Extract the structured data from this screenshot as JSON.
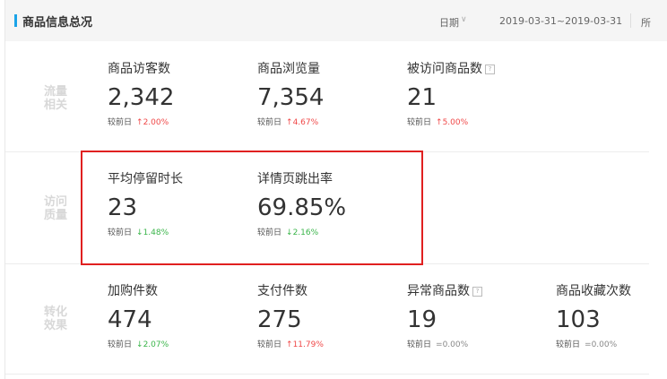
{
  "header": {
    "title": "商品信息总况",
    "date_label": "日期",
    "date_range": "2019-03-31~2019-03-31",
    "extra_text": "所",
    "accent_color": "#1aa3e8"
  },
  "colors": {
    "up": "#f04848",
    "down": "#3ab54a",
    "flat": "#888888",
    "group_label": "#d8d8d8",
    "highlight": "#e02020"
  },
  "compare_label": "较前日",
  "groups": [
    {
      "label": "流量相关",
      "label_lines": [
        "流量",
        "相关"
      ],
      "metrics": [
        {
          "label": "商品访客数",
          "value": "2,342",
          "trend": "up",
          "arrow": "↑",
          "change": "2.00%",
          "info": false
        },
        {
          "label": "商品浏览量",
          "value": "7,354",
          "trend": "up",
          "arrow": "↑",
          "change": "4.67%",
          "info": false
        },
        {
          "label": "被访问商品数",
          "value": "21",
          "trend": "up",
          "arrow": "↑",
          "change": "5.00%",
          "info": true
        }
      ]
    },
    {
      "label": "访问质量",
      "label_lines": [
        "访问",
        "质量"
      ],
      "metrics": [
        {
          "label": "平均停留时长",
          "value": "23",
          "trend": "down",
          "arrow": "↓",
          "change": "1.48%",
          "info": false
        },
        {
          "label": "详情页跳出率",
          "value": "69.85%",
          "trend": "down",
          "arrow": "↓",
          "change": "2.16%",
          "info": false
        }
      ]
    },
    {
      "label": "转化效果",
      "label_lines": [
        "转化",
        "效果"
      ],
      "metrics": [
        {
          "label": "加购件数",
          "value": "474",
          "trend": "down",
          "arrow": "↓",
          "change": "2.07%",
          "info": false
        },
        {
          "label": "支付件数",
          "value": "275",
          "trend": "up",
          "arrow": "↑",
          "change": "11.79%",
          "info": false
        },
        {
          "label": "异常商品数",
          "value": "19",
          "trend": "flat",
          "arrow": "=",
          "change": "0.00%",
          "info": true
        },
        {
          "label": "商品收藏次数",
          "value": "103",
          "trend": "flat",
          "arrow": "=",
          "change": "0.00%",
          "info": false
        }
      ]
    }
  ],
  "info_icon": "question-mark-icon"
}
